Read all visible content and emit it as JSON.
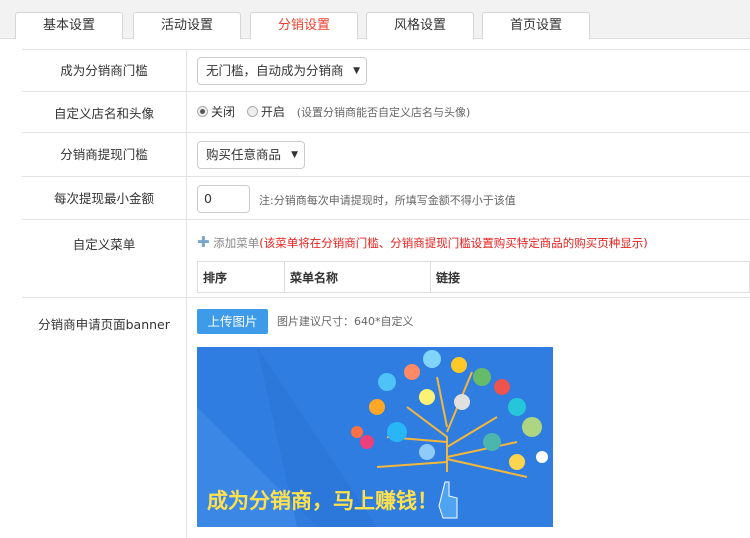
{
  "tabs": [
    {
      "label": "基本设置"
    },
    {
      "label": "活动设置"
    },
    {
      "label": "分销设置"
    },
    {
      "label": "风格设置"
    },
    {
      "label": "首页设置"
    }
  ],
  "active_tab": "分销设置",
  "form": {
    "threshold": {
      "label": "成为分销商门槛",
      "value": "无门槛，自动成为分销商"
    },
    "custom_shop": {
      "label": "自定义店名和头像",
      "off": "关闭",
      "on": "开启",
      "selected": "关闭",
      "hint": "(设置分销商能否自定义店名与头像)"
    },
    "withdraw_threshold": {
      "label": "分销商提现门槛",
      "value": "购买任意商品"
    },
    "min_withdraw": {
      "label": "每次提现最小金额",
      "value": "0",
      "hint": "注:分销商每次申请提现时，所填写金额不得小于该值"
    },
    "custom_menu": {
      "label": "自定义菜单",
      "add": "添加菜单",
      "note": "(该菜单将在分销商门槛、分销商提现门槛设置购买特定商品的购买页种显示)",
      "columns": [
        "排序",
        "菜单名称",
        "链接"
      ]
    },
    "banner": {
      "label": "分销商申请页面banner",
      "upload": "上传图片",
      "hint": "图片建议尺寸：640*自定义",
      "slogan": "成为分销商，马上赚钱！"
    }
  },
  "colors": {
    "accent": "#e8402d",
    "button": "#3d9be9",
    "banner_bg": "#2f7de0",
    "slogan": "#ffe14d"
  }
}
